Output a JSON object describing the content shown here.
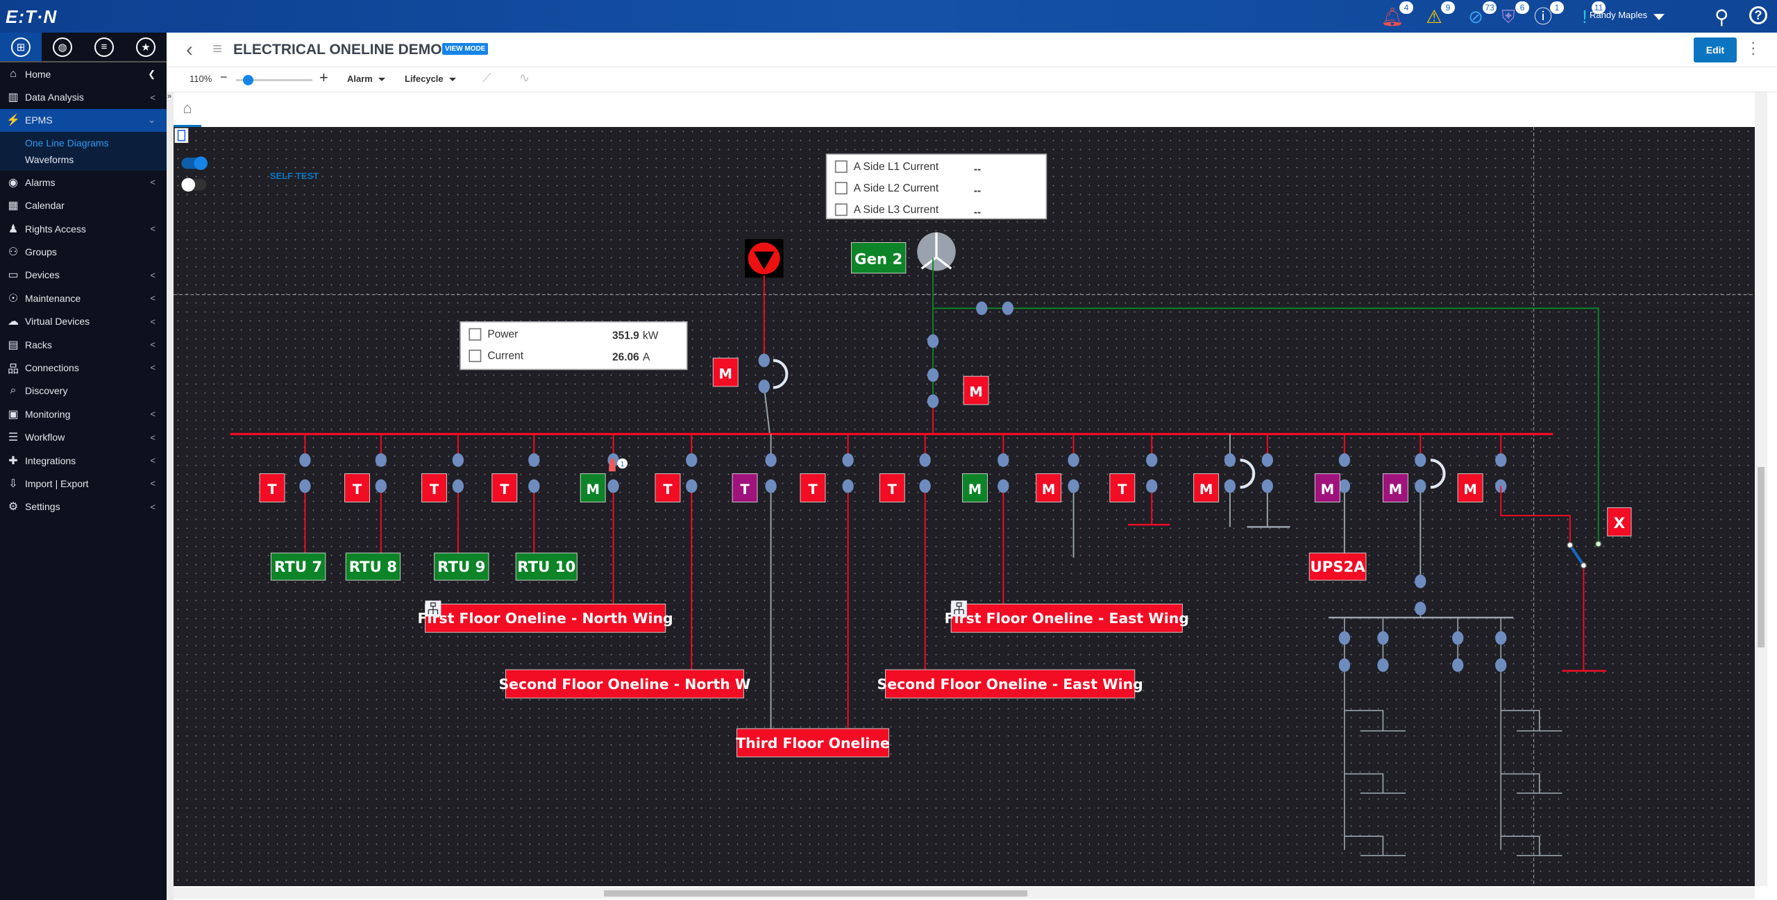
{
  "header": {
    "logo": "E:T·N",
    "user": "Randy Maples",
    "notifications": [
      {
        "icon": "bell-icon",
        "count": "4",
        "color": "#f04e4e"
      },
      {
        "icon": "warning-icon",
        "count": "9",
        "color": "#f5c400"
      },
      {
        "icon": "disabled-icon",
        "count": "73",
        "color": "#3aa0f0"
      },
      {
        "icon": "shield-alert-icon",
        "count": "6",
        "color": "#9b86d6"
      },
      {
        "icon": "info-icon",
        "count": "1",
        "color": "#ffffff"
      },
      {
        "icon": "bracket-alert-icon",
        "count": "11",
        "color": "#20d0e0"
      }
    ]
  },
  "sidebar": {
    "items": [
      {
        "label": "Home",
        "icon": "home-icon",
        "glyph": "⌂"
      },
      {
        "label": "Data Analysis",
        "icon": "chart-icon",
        "glyph": "▥"
      },
      {
        "label": "EPMS",
        "icon": "bolt-gear-icon",
        "glyph": "⚡",
        "active": true,
        "sub": [
          "One Line Diagrams",
          "Waveforms"
        ]
      },
      {
        "label": "Alarms",
        "icon": "alarm-icon",
        "glyph": "◉"
      },
      {
        "label": "Calendar",
        "icon": "calendar-icon",
        "glyph": "▦"
      },
      {
        "label": "Rights Access",
        "icon": "user-gear-icon",
        "glyph": "♟"
      },
      {
        "label": "Groups",
        "icon": "groups-icon",
        "glyph": "⚇"
      },
      {
        "label": "Devices",
        "icon": "device-icon",
        "glyph": "▭"
      },
      {
        "label": "Maintenance",
        "icon": "maintenance-icon",
        "glyph": "☉"
      },
      {
        "label": "Virtual Devices",
        "icon": "cloud-server-icon",
        "glyph": "☁"
      },
      {
        "label": "Racks",
        "icon": "rack-icon",
        "glyph": "▤"
      },
      {
        "label": "Connections",
        "icon": "network-icon",
        "glyph": "品"
      },
      {
        "label": "Discovery",
        "icon": "discovery-icon",
        "glyph": "⌕"
      },
      {
        "label": "Monitoring",
        "icon": "monitor-icon",
        "glyph": "▣"
      },
      {
        "label": "Workflow",
        "icon": "workflow-icon",
        "glyph": "☰"
      },
      {
        "label": "Integrations",
        "icon": "puzzle-icon",
        "glyph": "✚"
      },
      {
        "label": "Import | Export",
        "icon": "import-icon",
        "glyph": "⇩"
      },
      {
        "label": "Settings",
        "icon": "gear-icon",
        "glyph": "⚙"
      }
    ]
  },
  "page": {
    "title": "ELECTRICAL ONELINE DEMO",
    "mode": "VIEW MODE",
    "edit": "Edit",
    "zoom": "110%",
    "zoom_slider_fraction": 0.15,
    "alarm": "Alarm",
    "lifecycle": "Lifecycle"
  },
  "diagram": {
    "self_test": "SELF TEST",
    "gen": "Gen 2",
    "a_side": [
      {
        "label": "A Side L1 Current",
        "value": "--"
      },
      {
        "label": "A Side L2 Current",
        "value": "--"
      },
      {
        "label": "A Side L3 Current",
        "value": "--"
      }
    ],
    "meter": [
      {
        "label": "Power",
        "value": "351.9",
        "unit": "kW"
      },
      {
        "label": "Current",
        "value": "26.06",
        "unit": "A"
      }
    ],
    "m_upper": "M",
    "m_gen": "M",
    "alarm_badge": "1",
    "breakers": [
      {
        "label": "T",
        "color": "#f20c24"
      },
      {
        "label": "T",
        "color": "#f20c24"
      },
      {
        "label": "T",
        "color": "#f20c24"
      },
      {
        "label": "T",
        "color": "#f20c24"
      },
      {
        "label": "M",
        "color": "#0c8427"
      },
      {
        "label": "T",
        "color": "#f20c24"
      },
      {
        "label": "T",
        "color": "#a0137c"
      },
      {
        "label": "T",
        "color": "#f20c24"
      },
      {
        "label": "T",
        "color": "#f20c24"
      },
      {
        "label": "M",
        "color": "#0c8427"
      },
      {
        "label": "M",
        "color": "#f20c24"
      },
      {
        "label": "T",
        "color": "#f20c24"
      },
      {
        "label": "M",
        "color": "#f20c24"
      },
      null,
      {
        "label": "M",
        "color": "#a0137c"
      },
      {
        "label": "M",
        "color": "#a0137c"
      },
      {
        "label": "M",
        "color": "#f20c24"
      }
    ],
    "rtus": [
      "RTU 7",
      "RTU 8",
      "RTU 9",
      "RTU 10"
    ],
    "floors": [
      "First Floor Oneline - North Wing",
      "Second Floor Oneline - North W",
      "Third Floor Oneline",
      "Second Floor Oneline - East Wing",
      "First Floor Oneline - East Wing"
    ],
    "ups": "UPS2A",
    "x": "X",
    "colors": {
      "live": "#f20c24",
      "dead": "#9aa3ad",
      "gen": "#0c8427",
      "node": "#6f8cbf"
    }
  }
}
